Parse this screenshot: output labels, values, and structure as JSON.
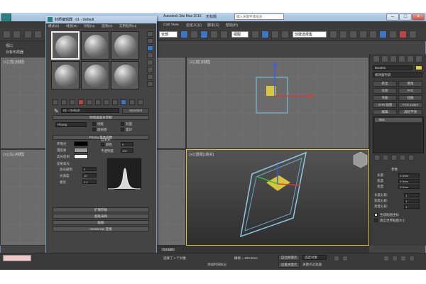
{
  "app": {
    "title": "Autodesk 3ds Max 2016",
    "subtitle": "无标题",
    "search_placeholder": "键入关键字或短语"
  },
  "menubar": {
    "items": [
      "编辑(E)",
      "工具(T)",
      "组(G)",
      "视图(V)",
      "创建(C)",
      "修改器",
      "动画",
      "图形编辑器",
      "渲染(R)",
      "Civil View",
      "自定义(U)",
      "脚本(S)",
      "帮助(H)"
    ]
  },
  "toolbar": {
    "selection_filter": "全部",
    "view_dropdown": "视图",
    "named_selection": "创建选择集"
  },
  "left_panel": {
    "items": [
      "视口",
      "对象布局器"
    ]
  },
  "material_editor": {
    "title": "材质编辑器 - 01 - Default",
    "menu": [
      "模式(D)",
      "材质(M)",
      "导航(N)",
      "选项(O)",
      "实用程序(U)"
    ],
    "material_name": "01 - Default",
    "material_type": "Standard",
    "shader_rollout": "明暗器基本参数",
    "shader_type": "Phong",
    "shader_options": [
      "线框",
      "双面",
      "面贴图",
      "面状"
    ],
    "basic_rollout": "Phong 基本参数",
    "self_illum": "自发光",
    "color_label": "颜色",
    "color_value": "0",
    "opacity_label": "不透明度",
    "opacity_value": "100",
    "ambient_label": "环境光",
    "diffuse_label": "漫反射",
    "specular_label": "高光反射",
    "specular_highlights": "反射高光",
    "specular_level_label": "高光级别",
    "specular_level_value": "0",
    "glossiness_label": "光泽度",
    "glossiness_value": "10",
    "soften_label": "柔化",
    "soften_value": "0.1",
    "collapsed_rollouts": [
      "扩展参数",
      "超级采样",
      "贴图",
      "mental ray 连接"
    ]
  },
  "viewports": {
    "top": "[+] [顶] [线框]",
    "front": "[+] [前] [线框]",
    "left": "[+] [左] [线框]",
    "perspective": "[+] [透视] [真实]"
  },
  "command_panel": {
    "object_name": "Box001",
    "modifier_list": "修改器列表",
    "buttons": [
      "挤出",
      "倒角",
      "车削",
      "FFD",
      "弯曲",
      "扭曲",
      "UVW 贴图",
      "FFD 4x4x4",
      "编辑",
      "涡轮平滑"
    ],
    "stack_item": "Box",
    "params_title": "参数",
    "params": [
      {
        "label": "长度:",
        "value": "0.0mm"
      },
      {
        "label": "宽度:",
        "value": "0.0mm"
      },
      {
        "label": "高度:",
        "value": "0.0mm"
      },
      {
        "label": "长度分段:",
        "value": "1"
      },
      {
        "label": "宽度分段:",
        "value": "1"
      },
      {
        "label": "高度分段:",
        "value": "1"
      }
    ],
    "options": [
      "生成贴图坐标",
      "真实世界贴图大小"
    ]
  },
  "status": {
    "frame_counter": "0 / 100",
    "selected": "选择了 1 个对象",
    "grid": "栅格 = 100.0mm",
    "auto_key": "自动关键点",
    "set_key": "设置关键点",
    "filter": "选定对象",
    "add_time_tag": "添加时间标记",
    "key_filters": "关键点过滤器"
  }
}
